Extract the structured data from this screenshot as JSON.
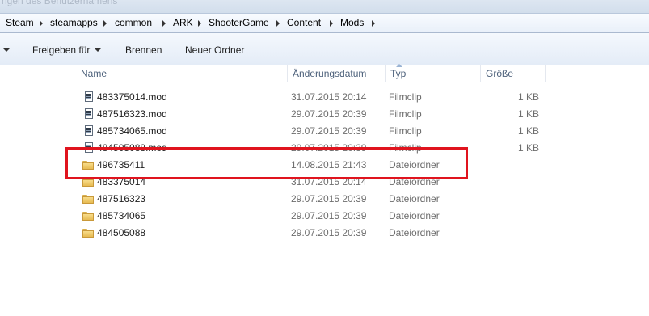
{
  "window": {
    "title_fragment": "ngen des Benutzernamens"
  },
  "breadcrumb": [
    "Steam",
    "steamapps",
    "common",
    "ARK",
    "ShooterGame",
    "Content",
    "Mods"
  ],
  "toolbar": {
    "share_label": "Freigeben für",
    "burn_label": "Brennen",
    "new_folder_label": "Neuer Ordner"
  },
  "columns": {
    "name": "Name",
    "date": "Änderungsdatum",
    "type": "Typ",
    "size": "Größe"
  },
  "files": [
    {
      "name": "483375014.mod",
      "date": "31.07.2015 20:14",
      "type": "Filmclip",
      "size": "1 KB",
      "icon": "video-file-icon"
    },
    {
      "name": "487516323.mod",
      "date": "29.07.2015 20:39",
      "type": "Filmclip",
      "size": "1 KB",
      "icon": "video-file-icon"
    },
    {
      "name": "485734065.mod",
      "date": "29.07.2015 20:39",
      "type": "Filmclip",
      "size": "1 KB",
      "icon": "video-file-icon"
    },
    {
      "name": "484505088.mod",
      "date": "29.07.2015 20:39",
      "type": "Filmclip",
      "size": "1 KB",
      "icon": "video-file-icon"
    },
    {
      "name": "496735411",
      "date": "14.08.2015 21:43",
      "type": "Dateiordner",
      "size": "",
      "icon": "folder-icon"
    },
    {
      "name": "483375014",
      "date": "31.07.2015 20:14",
      "type": "Dateiordner",
      "size": "",
      "icon": "folder-icon"
    },
    {
      "name": "487516323",
      "date": "29.07.2015 20:39",
      "type": "Dateiordner",
      "size": "",
      "icon": "folder-icon"
    },
    {
      "name": "485734065",
      "date": "29.07.2015 20:39",
      "type": "Dateiordner",
      "size": "",
      "icon": "folder-icon"
    },
    {
      "name": "484505088",
      "date": "29.07.2015 20:39",
      "type": "Dateiordner",
      "size": "",
      "icon": "folder-icon"
    }
  ],
  "highlight": {
    "row_name": "496735411",
    "color": "#e0141e"
  }
}
